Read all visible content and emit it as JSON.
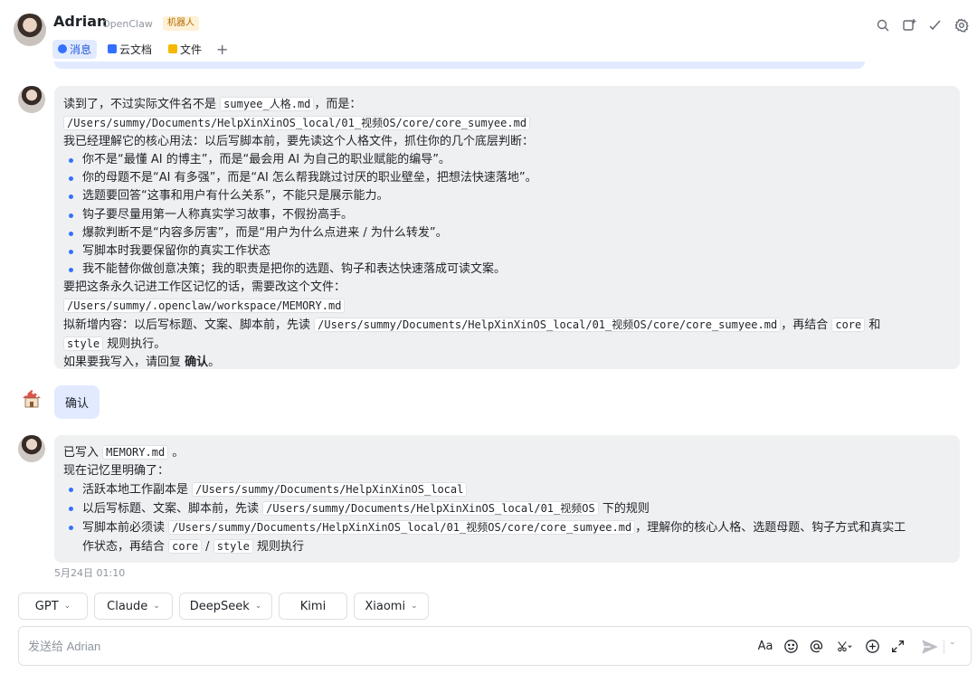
{
  "header": {
    "name": "Adrian",
    "subtitle": "OpenClaw",
    "badge": "机器人",
    "tabs": [
      {
        "label": "消息",
        "icon": "message-icon"
      },
      {
        "label": "云文档",
        "icon": "doc-icon"
      },
      {
        "label": "文件",
        "icon": "folder-icon"
      }
    ],
    "add_tab": "+",
    "actions": [
      "search-icon",
      "new-window-icon",
      "check-icon",
      "settings-icon"
    ]
  },
  "messages": {
    "m1": {
      "l1a": "读到了，不过实际文件名不是 ",
      "l1code": "sumyee_人格.md",
      "l1b": "，而是：",
      "l2code": "/Users/summy/Documents/HelpXinXinOS_local/01_视频OS/core/core_sumyee.md",
      "l3": "我已经理解它的核心用法：以后写脚本前，要先读这个人格文件，抓住你的几个底层判断：",
      "bullets": [
        "你不是“最懂 AI 的博主”，而是“最会用 AI 为自己的职业赋能的编导”。",
        "你的母题不是“AI 有多强”，而是“AI 怎么帮我跳过讨厌的职业壁垒，把想法快速落地”。",
        "选题要回答“这事和用户有什么关系”，不能只是展示能力。",
        "钩子要尽量用第一人称真实学习故事，不假扮高手。",
        "爆款判断不是“内容多厉害”，而是“用户为什么点进来 / 为什么转发”。",
        "写脚本时我要保留你的真实工作状态",
        "我不能替你做创意决策；我的职责是把你的选题、钩子和表达快速落成可读文案。"
      ],
      "l4": "要把这条永久记进工作区记忆的话，需要改这个文件：",
      "l5code": "/Users/summy/.openclaw/workspace/MEMORY.md",
      "l6a": "拟新增内容：以后写标题、文案、脚本前，先读 ",
      "l6code": "/Users/summy/Documents/HelpXinXinOS_local/01_视频OS/core/core_sumyee.md",
      "l6b": "，再结合 ",
      "l6code2": "core",
      "l6c": " 和",
      "l7code": "style",
      "l7b": " 规则执行。",
      "l8a": "如果要我写入，请回复 ",
      "l8b": "确认",
      "l8c": "。"
    },
    "m2": {
      "text": "确认"
    },
    "m3": {
      "l1a": "已写入 ",
      "l1code": "MEMORY.md",
      "l1b": " 。",
      "l2": "现在记忆里明确了：",
      "b1a": "活跃本地工作副本是 ",
      "b1code": "/Users/summy/Documents/HelpXinXinOS_local",
      "b2a": "以后写标题、文案、脚本前，先读 ",
      "b2code": "/Users/summy/Documents/HelpXinXinOS_local/01_视频OS",
      "b2b": " 下的规则",
      "b3a": "写脚本前必须读 ",
      "b3code": "/Users/summy/Documents/HelpXinXinOS_local/01_视频OS/core/core_sumyee.md",
      "b3b": "，理解你的核心人格、选题母题、钩子方式和真实工",
      "b3c": "作状态，再结合 ",
      "b3code2": "core",
      "b3d": " / ",
      "b3code3": "style",
      "b3e": " 规则执行"
    },
    "timestamp": "5月24日 01:10"
  },
  "models": [
    {
      "label": "GPT",
      "dropdown": true
    },
    {
      "label": "Claude",
      "dropdown": true
    },
    {
      "label": "DeepSeek",
      "dropdown": true
    },
    {
      "label": "Kimi",
      "dropdown": false
    },
    {
      "label": "Xiaomi",
      "dropdown": true
    }
  ],
  "input": {
    "placeholder": "发送给 Adrian",
    "value": "",
    "format_label": "Aa"
  },
  "colors": {
    "accent": "#3370ff",
    "bubble_bot": "#eff0f1",
    "bubble_user": "#e1eaff"
  }
}
